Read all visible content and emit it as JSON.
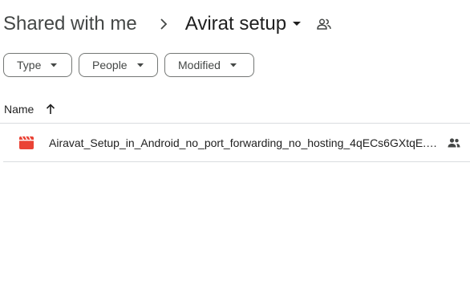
{
  "breadcrumb": {
    "root_label": "Shared with me",
    "current_label": "Avirat setup"
  },
  "filters": [
    {
      "label": "Type"
    },
    {
      "label": "People"
    },
    {
      "label": "Modified"
    }
  ],
  "list": {
    "column_name": "Name",
    "sort_direction": "ascending",
    "rows": [
      {
        "name": "Airavat_Setup_in_Android_no_port_forwarding_no_hosting_4qECs6GXtqE.mp4",
        "icon": "video-file-icon",
        "shared": true
      }
    ]
  },
  "colors": {
    "video_icon": "#ea4335",
    "text_primary": "#1f1f1f",
    "text_secondary": "#444746",
    "divider": "#dadce0"
  }
}
